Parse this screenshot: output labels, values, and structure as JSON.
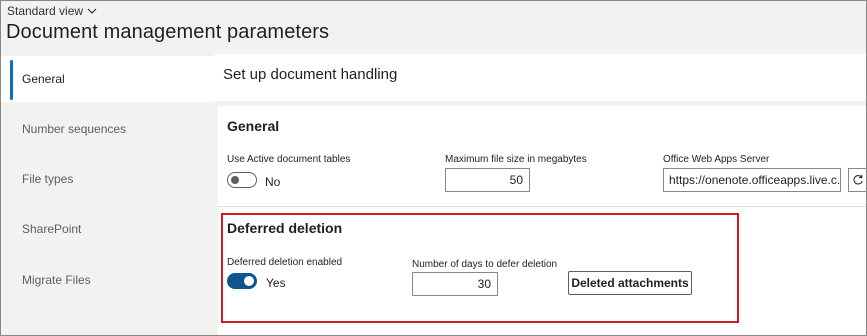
{
  "header": {
    "view_label": "Standard view",
    "title": "Document management parameters"
  },
  "sidebar": {
    "items": [
      {
        "label": "General",
        "active": true
      },
      {
        "label": "Number sequences",
        "active": false
      },
      {
        "label": "File types",
        "active": false
      },
      {
        "label": "SharePoint",
        "active": false
      },
      {
        "label": "Migrate Files",
        "active": false
      }
    ]
  },
  "main": {
    "section_title": "Set up document handling",
    "general": {
      "title": "General",
      "active_tables": {
        "label": "Use Active document tables",
        "value": "No",
        "on": false
      },
      "max_file_size": {
        "label": "Maximum file size in megabytes",
        "value": "50"
      },
      "office_server": {
        "label": "Office Web Apps Server",
        "value": "https://onenote.officeapps.live.c..."
      }
    },
    "deferred": {
      "title": "Deferred deletion",
      "enabled": {
        "label": "Deferred deletion enabled",
        "value": "Yes",
        "on": true
      },
      "days": {
        "label": "Number of days to defer deletion",
        "value": "30"
      },
      "button_label": "Deleted attachments"
    }
  },
  "colors": {
    "accent": "#0f6cbd",
    "toggle_on": "#0f548c",
    "highlight": "#d71921",
    "background": "#f3f2f1"
  }
}
